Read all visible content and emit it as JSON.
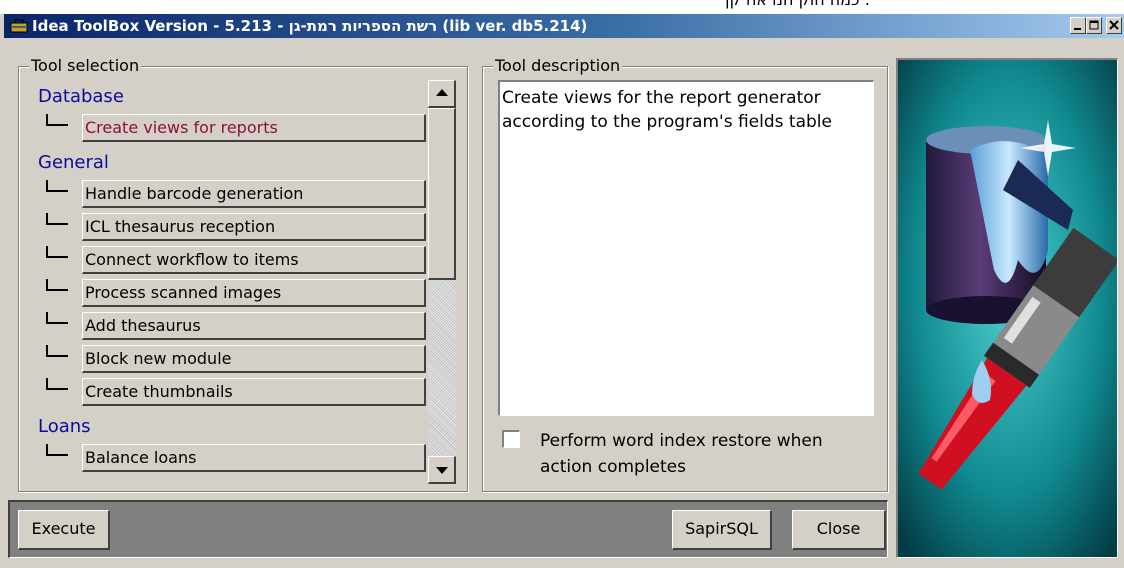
{
  "top_fragment": "כמה חוק חנו אח קן :",
  "window": {
    "title": "Idea ToolBox  Version - 5.213 - רשת הספריות רמת-גן (lib ver. db5.214)",
    "minimize_label": "_",
    "maximize_label": "□",
    "close_label": "×"
  },
  "tool_selection": {
    "label": "Tool selection",
    "categories": [
      {
        "name": "Database",
        "items": [
          "Create views for reports"
        ]
      },
      {
        "name": "General",
        "items": [
          "Handle barcode generation",
          "ICL thesaurus reception",
          "Connect workflow to items",
          "Process scanned images",
          "Add thesaurus",
          "Block new module",
          "Create thumbnails"
        ]
      },
      {
        "name": "Loans",
        "items": [
          "Balance loans"
        ]
      }
    ],
    "selected_item": "Create views for reports"
  },
  "tool_description": {
    "label": "Tool description",
    "text_line1": "Create views for the report generator",
    "text_line2": "according to the program's fields table",
    "checkbox_label_line1": "Perform word index restore when",
    "checkbox_label_line2": "action completes",
    "checkbox_checked": false
  },
  "buttons": {
    "execute": "Execute",
    "sapirsql": "SapirSQL",
    "close": "Close"
  },
  "colors": {
    "category": "#0c0c9c",
    "selected_item": "#8a1040",
    "panel_bg": "#0f7f86"
  }
}
